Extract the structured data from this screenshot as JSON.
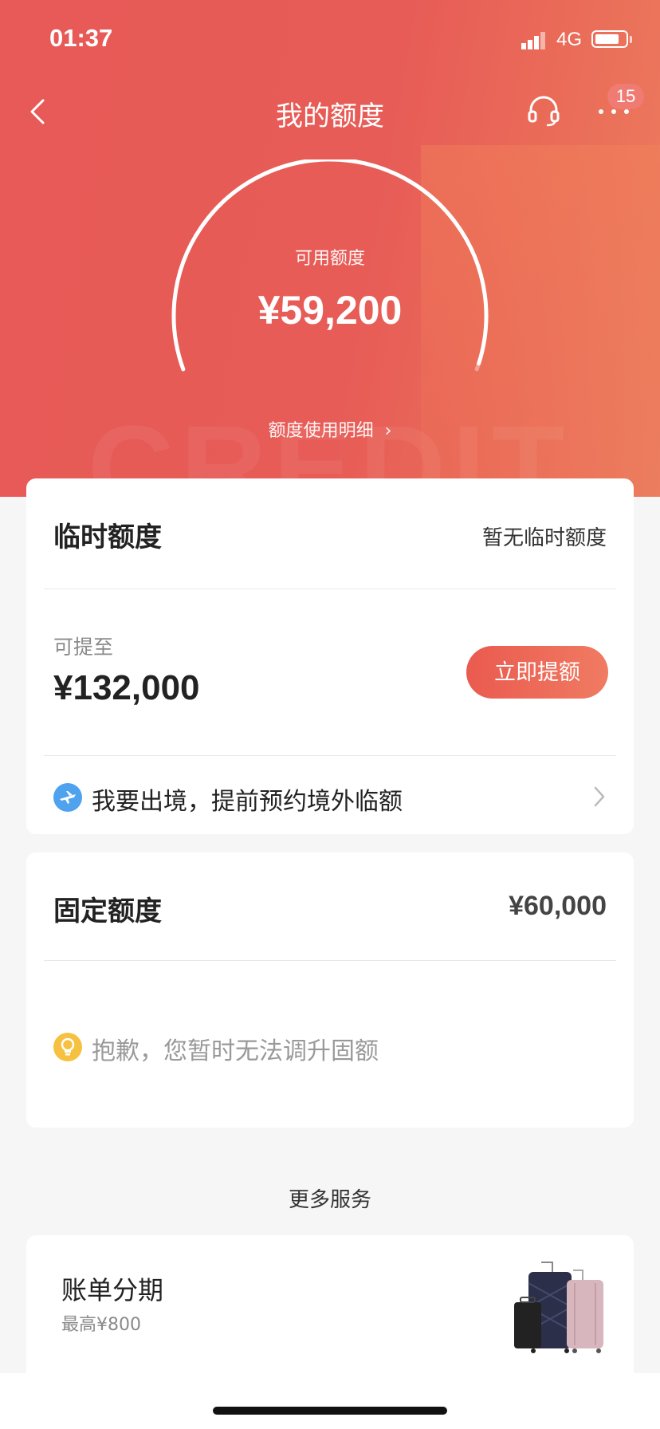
{
  "status_bar": {
    "time": "01:37",
    "network": "4G",
    "battery_level": 0.75
  },
  "nav": {
    "title": "我的额度",
    "badge_count": "15"
  },
  "gauge": {
    "label": "可用额度",
    "value": "¥59,200",
    "detail_link": "额度使用明细",
    "fill_fraction": 0.99
  },
  "temp_quota": {
    "title": "临时额度",
    "status": "暂无临时额度",
    "raise_label": "可提至",
    "raise_amount": "¥132,000",
    "raise_button": "立即提额",
    "abroad_text": "我要出境，提前预约境外临额"
  },
  "fixed_quota": {
    "title": "固定额度",
    "amount": "¥60,000",
    "notice": "抱歉，您暂时无法调升固额"
  },
  "more_services": {
    "title": "更多服务",
    "items": [
      {
        "title": "账单分期",
        "subtitle": "最高¥800"
      }
    ]
  },
  "colors": {
    "primary": "#e75a57",
    "button_start": "#ea5a4f",
    "button_end": "#f07b62"
  }
}
